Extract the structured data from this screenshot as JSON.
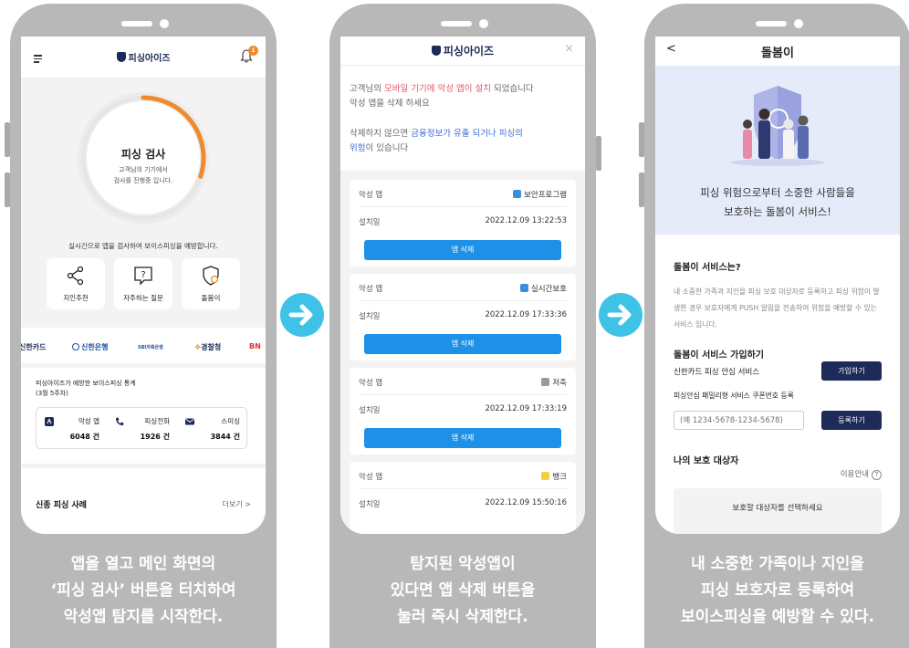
{
  "phone1": {
    "brand": "피싱아이즈",
    "notification_count": "1",
    "scan_title": "피싱 검사",
    "scan_sub_1": "고객님의 기기에서",
    "scan_sub_2": "검사를 진행중 입니다.",
    "scan_progress": 0.3,
    "realtime_text": "실시간으로 앱을 검사하여 보이스피싱을 예방합니다.",
    "quick_menu": [
      {
        "label": "지인추천",
        "icon": "share-icon"
      },
      {
        "label": "자주하는 질문",
        "icon": "faq-icon"
      },
      {
        "label": "돌봄이",
        "icon": "shield-care-icon"
      }
    ],
    "partners": [
      "신한카드",
      "신한은행",
      "SBI저축은행",
      "경찰청",
      "BN"
    ],
    "stats_title_1": "피싱아이즈가 예방한 보이스피싱 통계",
    "stats_title_2": "(3월 5주차)",
    "stats": [
      {
        "label": "악성 앱",
        "value": "6048 건",
        "icon": "app-icon"
      },
      {
        "label": "피싱전화",
        "value": "1926 건",
        "icon": "phone-icon"
      },
      {
        "label": "스미싱",
        "value": "3844 건",
        "icon": "mail-icon"
      }
    ],
    "new_case_title": "신종 피싱 사례",
    "more_label": "더보기 >",
    "caption": [
      "앱을 열고 메인 화면의",
      "‘피싱 검사’ 버튼을 터치하여",
      "악성앱 탐지를 시작한다."
    ]
  },
  "phone2": {
    "brand": "피싱아이즈",
    "close_label": "×",
    "alert1_pre": "고객님의 ",
    "alert1_red": "모바일 기기에 악성 앱이 설치",
    "alert1_post": " 되었습니다",
    "alert1_line2": "악성 앱을 삭제 하세요",
    "alert2_pre": "삭제하지 않으면 ",
    "alert2_blue1": "금융정보가 유출 되거나 피싱의",
    "alert2_blue2": "위험",
    "alert2_post": "이 있습니다",
    "malicious_label": "악성 앱",
    "install_label": "설치일",
    "delete_label": "앱 삭제",
    "apps": [
      {
        "name": "보안프로그램",
        "date": "2022.12.09 13:22:53",
        "icon_color": "#3c8fe0"
      },
      {
        "name": "실시간보호",
        "date": "2022.12.09 17:33:36",
        "icon_color": "#3c8fe0"
      },
      {
        "name": "저축",
        "date": "2022.12.09 17:33:19",
        "icon_color": "#999999"
      },
      {
        "name": "뱅크",
        "date": "2022.12.09 15:50:16",
        "icon_color": "#f2d23b"
      }
    ],
    "caption": [
      "탐지된 악성앱이",
      "있다면 앱 삭제 버튼을",
      "눌러 즉시 삭제한다."
    ]
  },
  "phone3": {
    "title": "돌봄이",
    "back_label": "<",
    "hero_line1": "피싱 위험으로부터 소중한 사람들을",
    "hero_line2": "보호하는 돌봄이 서비스!",
    "service_title": "돌봄이 서비스는?",
    "service_desc": "내 소중한 가족과 지인을 피싱 보호 대상자로 등록하고 피싱 위험이 발생한 경우 보호자에게 PUSH 알림을 전송하여 위험을 예방할 수 있는 서비스 입니다.",
    "join_title": "돌봄이 서비스 가입하기",
    "shinhan_label": "신한카드 피싱 안심 서비스",
    "join_button": "가입하기",
    "coupon_label": "피싱안심 패밀리형 서비스 쿠폰번호 등록",
    "coupon_placeholder": "(예 1234-5678-1234-5678)",
    "register_button": "등록하기",
    "protect_title": "나의 보호 대상자",
    "guide_label": "이용안내",
    "select_label": "보호할 대상자를 선택하세요",
    "caption": [
      "내 소중한 가족이나 지인을",
      "피싱 보호자로 등록하여",
      "보이스피싱을 예방할 수 있다."
    ]
  },
  "colors": {
    "navy": "#1e2a58",
    "accent_orange": "#f08a2e",
    "delete_blue": "#1e90e8",
    "arrow_cyan": "#3ec3e6",
    "phone_gray": "#b8b8b8"
  }
}
